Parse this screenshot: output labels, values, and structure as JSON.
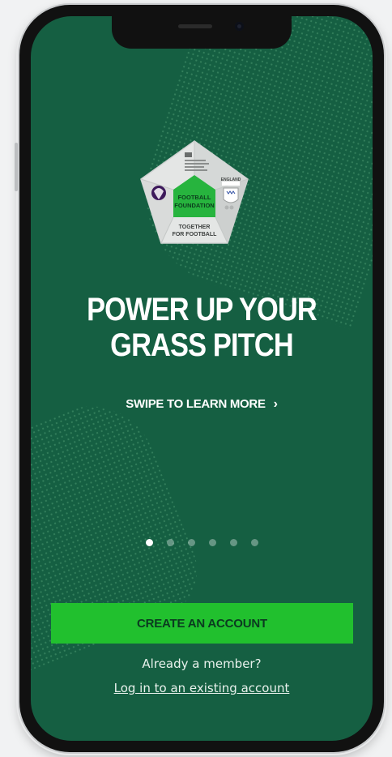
{
  "logo": {
    "center_text_line1": "FOOTBALL",
    "center_text_line2": "FOUNDATION",
    "bottom_text_line1": "TOGETHER",
    "bottom_text_line2": "FOR FOOTBALL",
    "right_text": "ENGLAND",
    "colors": {
      "face": "#e4e6e5",
      "face_shade": "#c9cccb",
      "center": "#27b43e"
    }
  },
  "hero": {
    "line1": "POWER UP YOUR",
    "line2": "GRASS PITCH",
    "swipe_label": "SWIPE TO LEARN MORE",
    "swipe_chevron": "›"
  },
  "pager": {
    "count": 6,
    "active_index": 0
  },
  "actions": {
    "create_account": "CREATE AN ACCOUNT",
    "already_member": "Already a member?",
    "login_link": "Log in to an existing account"
  },
  "colors": {
    "screen_bg": "#155f42",
    "cta_bg": "#21c02e",
    "cta_text": "#0b3a20"
  }
}
